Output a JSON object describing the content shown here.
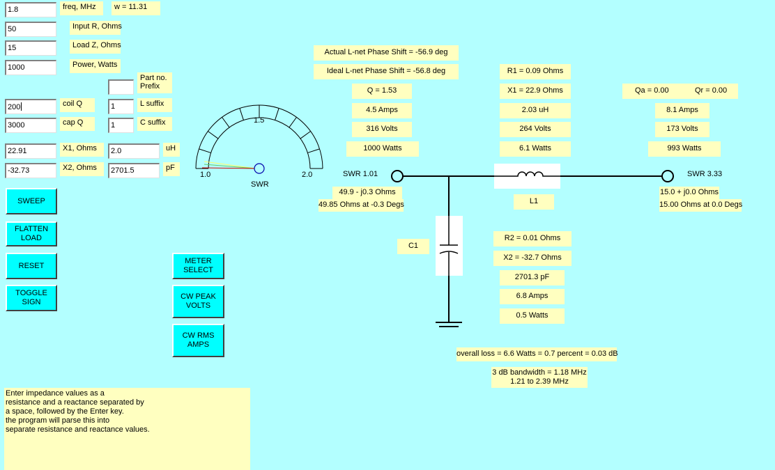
{
  "inputs": {
    "freq": "1.8",
    "input_r": "50",
    "load_z": "15",
    "power": "1000",
    "part_prefix": "",
    "coil_q": "200",
    "l_suffix": "1",
    "cap_q": "3000",
    "c_suffix": "1",
    "x1_ohms": "22.91",
    "uh": "2.0",
    "x2_ohms": "-32.73",
    "pf": "2701.5"
  },
  "labels": {
    "freq": "freq, MHz",
    "w": "w = 11.31",
    "input_r": "Input R, Ohms",
    "load_z": "Load Z, Ohms",
    "power": "Power, Watts",
    "part_prefix": "Part no.\nPrefix",
    "coil_q": "coil Q",
    "l_suffix": "L suffix",
    "cap_q": "cap Q",
    "c_suffix": "C suffix",
    "x1": "X1, Ohms",
    "uh": "uH",
    "x2": "X2, Ohms",
    "pf": "pF"
  },
  "buttons": {
    "sweep": "SWEEP",
    "flatten": "FLATTEN\nLOAD",
    "reset": "RESET",
    "toggle": "TOGGLE\nSIGN",
    "meter_select": "METER\nSELECT",
    "cw_peak": "CW PEAK\nVOLTS",
    "cw_rms": "CW RMS\nAMPS"
  },
  "meter": {
    "min_label": "1.0",
    "mid_label": "1.5",
    "max_label": "2.0",
    "title": "SWR",
    "swr_value": 1.01
  },
  "help_text": "Enter impedance values as a\nresistance and a reactance separated by\na space, followed by the Enter key.\nthe program will parse this into\nseparate resistance and reactance values.",
  "results": {
    "actual_phase": "Actual L-net Phase Shift = -56.9 deg",
    "ideal_phase": "Ideal L-net Phase Shift = -56.8 deg",
    "q": "Q = 1.53",
    "in_amps": "4.5 Amps",
    "in_volts": "316 Volts",
    "in_watts": "1000 Watts",
    "swr_in": "SWR 1.01",
    "in_z": "49.9 - j0.3 Ohms",
    "in_polar": "49.85 Ohms at -0.3 Degs",
    "r1": "R1 = 0.09 Ohms",
    "x1": "X1 = 22.9 Ohms",
    "l_uh": "2.03 uH",
    "l_volts": "264 Volts",
    "l_watts": "6.1 Watts",
    "l_name": "L1",
    "qa": "Qa = 0.00",
    "qr": "Qr = 0.00",
    "out_amps": "8.1 Amps",
    "out_volts": "173 Volts",
    "out_watts": "993 Watts",
    "swr_out": "SWR 3.33",
    "out_z": "15.0 + j0.0 Ohms",
    "out_polar": "15.00 Ohms at 0.0 Degs",
    "c_name": "C1",
    "r2": "R2 = 0.01 Ohms",
    "x2": "X2 = -32.7 Ohms",
    "c_pf": "2701.3 pF",
    "c_amps": "6.8 Amps",
    "c_watts": "0.5 Watts",
    "overall_loss": "overall loss = 6.6 Watts = 0.7 percent = 0.03 dB",
    "bandwidth": "3 dB bandwidth = 1.18 MHz",
    "bw_range": "1.21 to 2.39 MHz"
  },
  "colors": {
    "background": "#b3ffff",
    "label_bg": "#ffffc0",
    "button_bg": "#00ffff"
  }
}
